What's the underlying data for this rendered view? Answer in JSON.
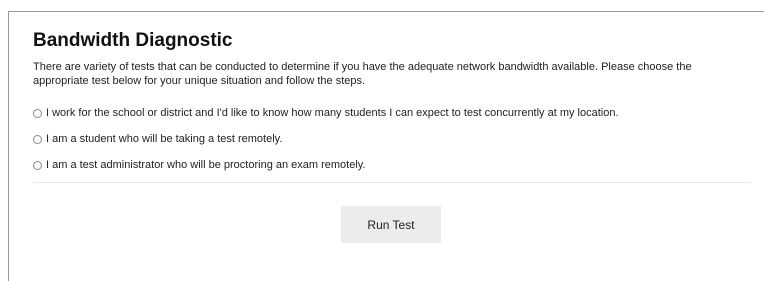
{
  "page": {
    "title": "Bandwidth Diagnostic",
    "description": "There are variety of tests that can be conducted to determine if you have the adequate network bandwidth available. Please choose the appropriate test below for your unique situation and follow the steps."
  },
  "options": [
    {
      "label": "I work for the school or district and I'd like to know how many students I can expect to test concurrently at my location.",
      "selected": false
    },
    {
      "label": "I am a student who will be taking a test remotely.",
      "selected": false
    },
    {
      "label": "I am a test administrator who will be proctoring an exam remotely.",
      "selected": false
    }
  ],
  "actions": {
    "run_label": "Run Test"
  }
}
